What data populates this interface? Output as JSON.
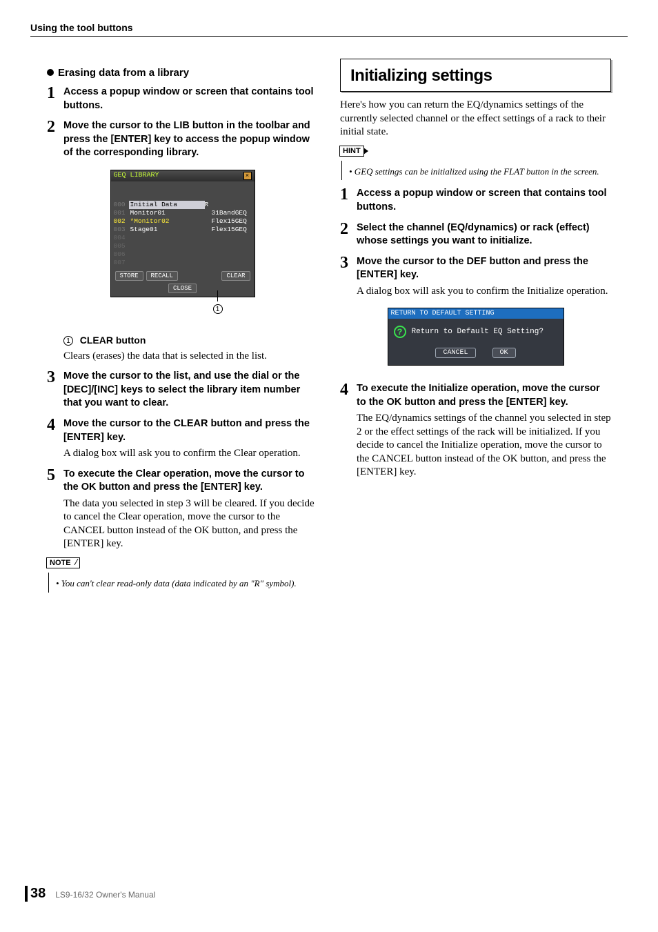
{
  "header": {
    "section": "Using the tool buttons"
  },
  "left": {
    "subheading": "Erasing data from a library",
    "step1": "Access a popup window or screen that contains tool buttons.",
    "step2": "Move the cursor to the LIB button in the toolbar and press the [ENTER] key to access the popup window of the corresponding library.",
    "geq": {
      "title": "GEQ LIBRARY",
      "rows": [
        {
          "idx": "000",
          "name": "Initial Data",
          "r": "R",
          "type": ""
        },
        {
          "idx": "001",
          "name": "Monitor01",
          "r": "",
          "type": "31BandGEQ"
        },
        {
          "idx": "002",
          "name": "*Monitor02",
          "r": "",
          "type": "Flex15GEQ"
        },
        {
          "idx": "003",
          "name": "Stage01",
          "r": "",
          "type": "Flex15GEQ"
        },
        {
          "idx": "004",
          "name": "",
          "r": "",
          "type": ""
        },
        {
          "idx": "005",
          "name": "",
          "r": "",
          "type": ""
        },
        {
          "idx": "006",
          "name": "",
          "r": "",
          "type": ""
        },
        {
          "idx": "007",
          "name": "",
          "r": "",
          "type": ""
        }
      ],
      "store": "STORE",
      "recall": "RECALL",
      "clear": "CLEAR",
      "close": "CLOSE"
    },
    "callout_num": "1",
    "clear_label": "CLEAR button",
    "clear_desc": "Clears (erases) the data that is selected in the list.",
    "step3": "Move the cursor to the list, and use the dial or the [DEC]/[INC] keys to select the library item number that you want to clear.",
    "step4": "Move the cursor to the CLEAR button and press the [ENTER] key.",
    "step4_body": "A dialog box will ask you to confirm the Clear operation.",
    "step5": "To execute the Clear operation, move the cursor to the OK button and press the [ENTER] key.",
    "step5_body": "The data you selected in step 3 will be cleared. If you decide to cancel the Clear operation, move the cursor to the CANCEL button instead of the OK button, and press the [ENTER] key.",
    "note_label": "NOTE",
    "note_text": "• You can't clear read-only data (data indicated by an \"R\" symbol)."
  },
  "right": {
    "title": "Initializing settings",
    "intro": "Here's how you can return the EQ/dynamics settings of the currently selected channel or the effect settings of a rack to their initial state.",
    "hint_label": "HINT",
    "hint_text": "• GEQ settings can be initialized using the FLAT button in the screen.",
    "step1": "Access a popup window or screen that contains tool buttons.",
    "step2": "Select the channel (EQ/dynamics) or rack (effect) whose settings you want to initialize.",
    "step3": "Move the cursor to the DEF button and press the [ENTER] key.",
    "step3_body": "A dialog box will ask you to confirm the Initialize operation.",
    "dialog": {
      "title": "RETURN TO DEFAULT SETTING",
      "question": "Return to Default EQ Setting?",
      "cancel": "CANCEL",
      "ok": "OK"
    },
    "step4": "To execute the Initialize operation, move the cursor to the OK button and press the [ENTER] key.",
    "step4_body": "The EQ/dynamics settings of the channel you selected in step 2 or the effect settings of the rack will be initialized. If you decide to cancel the Initialize operation, move the cursor to the CANCEL button instead of the OK button, and press the [ENTER] key."
  },
  "footer": {
    "page": "38",
    "book": "LS9-16/32  Owner's Manual"
  }
}
